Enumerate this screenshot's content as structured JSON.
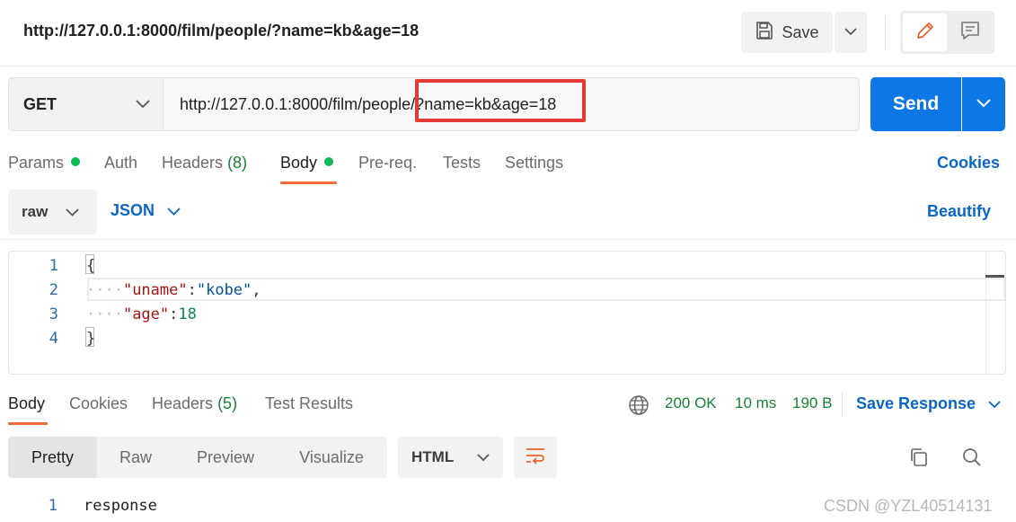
{
  "header": {
    "request_title": "http://127.0.0.1:8000/film/people/?name=kb&age=18",
    "save_label": "Save"
  },
  "request": {
    "method": "GET",
    "url": "http://127.0.0.1:8000/film/people/?name=kb&age=18",
    "send_label": "Send"
  },
  "request_tabs": {
    "params": "Params",
    "auth": "Auth",
    "headers": "Headers",
    "headers_count": "(8)",
    "body": "Body",
    "prereq": "Pre-req.",
    "tests": "Tests",
    "settings": "Settings",
    "cookies": "Cookies"
  },
  "body_toolbar": {
    "mode": "raw",
    "language": "JSON",
    "beautify": "Beautify"
  },
  "editor": {
    "line_numbers": [
      "1",
      "2",
      "3",
      "4"
    ],
    "open_brace": "{",
    "close_brace": "}",
    "indent": "····",
    "key1": "\"uname\"",
    "val1": "\"kobe\"",
    "key2": "\"age\"",
    "val2": "18",
    "colon": ":",
    "comma": ","
  },
  "response": {
    "tabs": {
      "body": "Body",
      "cookies": "Cookies",
      "headers": "Headers",
      "headers_count": "(5)",
      "test_results": "Test Results"
    },
    "status": "200 OK",
    "time": "10 ms",
    "size": "190 B",
    "save_response": "Save Response",
    "view_modes": [
      "Pretty",
      "Raw",
      "Preview",
      "Visualize"
    ],
    "format": "HTML",
    "line_number": "1",
    "content": "response"
  },
  "watermark": "CSDN @YZL40514131",
  "colors": {
    "accent_blue": "#0d77e6",
    "link_blue": "#0b66c4",
    "status_green": "#1a7f37",
    "dot_green": "#0cbb52",
    "tab_underline": "#f26b3a",
    "highlight_red": "#e53935"
  },
  "icons": [
    "save-icon",
    "chevron-down-icon",
    "pencil-icon",
    "comment-icon",
    "globe-icon",
    "wrap-lines-icon",
    "copy-icon",
    "search-icon"
  ]
}
